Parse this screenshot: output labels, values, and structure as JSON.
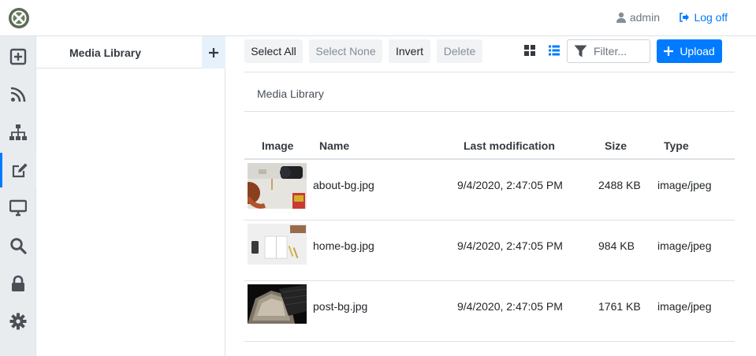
{
  "topbar": {
    "user": "admin",
    "logoff": "Log off"
  },
  "rail": {
    "items": [
      {
        "icon": "plus-square-icon"
      },
      {
        "icon": "rss-icon"
      },
      {
        "icon": "sitemap-icon"
      },
      {
        "icon": "edit-icon",
        "active": true
      },
      {
        "icon": "desktop-icon"
      },
      {
        "icon": "search-icon"
      },
      {
        "icon": "lock-icon"
      },
      {
        "icon": "gear-icon"
      }
    ]
  },
  "tree": {
    "title": "Media Library"
  },
  "toolbar": {
    "select_all": "Select All",
    "select_none": "Select None",
    "invert": "Invert",
    "delete": "Delete",
    "filter_placeholder": "Filter...",
    "upload": "Upload"
  },
  "breadcrumb": "Media Library",
  "table": {
    "headers": {
      "image": "Image",
      "name": "Name",
      "modified": "Last modification",
      "size": "Size",
      "type": "Type"
    },
    "rows": [
      {
        "name": "about-bg.jpg",
        "modified": "9/4/2020, 2:47:05 PM",
        "size": "2488 KB",
        "type": "image/jpeg"
      },
      {
        "name": "home-bg.jpg",
        "modified": "9/4/2020, 2:47:05 PM",
        "size": "984 KB",
        "type": "image/jpeg"
      },
      {
        "name": "post-bg.jpg",
        "modified": "9/4/2020, 2:47:05 PM",
        "size": "1761 KB",
        "type": "image/jpeg"
      }
    ]
  },
  "colors": {
    "accent": "#007bff",
    "rail_bg": "#e9ecef",
    "icon": "#495057"
  }
}
